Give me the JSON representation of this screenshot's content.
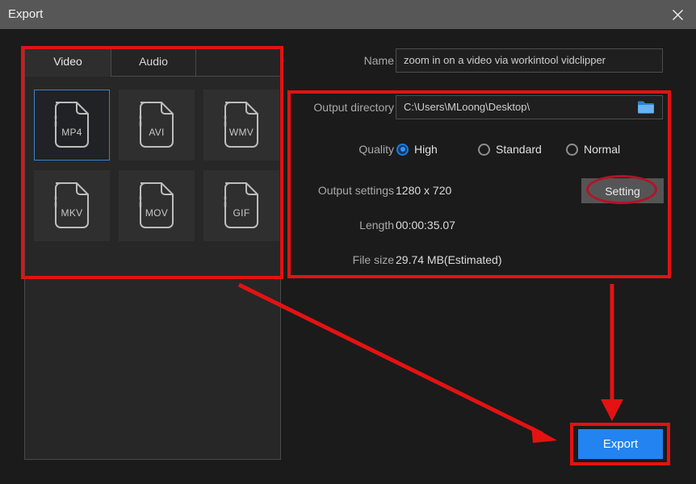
{
  "window": {
    "title": "Export",
    "close_icon": "close-icon"
  },
  "left_panel": {
    "tabs": [
      {
        "label": "Video",
        "active": true
      },
      {
        "label": "Audio",
        "active": false
      },
      {
        "label": "",
        "active": false
      }
    ],
    "formats": [
      {
        "label": "MP4",
        "selected": true
      },
      {
        "label": "AVI",
        "selected": false
      },
      {
        "label": "WMV",
        "selected": false
      },
      {
        "label": "MKV",
        "selected": false
      },
      {
        "label": "MOV",
        "selected": false
      },
      {
        "label": "GIF",
        "selected": false
      }
    ]
  },
  "form": {
    "name_label": "Name",
    "name_value": "zoom in on a video via workintool vidclipper",
    "name_placeholder": "File name",
    "directory_label": "Output directory",
    "directory_value": "C:\\Users\\MLoong\\Desktop\\",
    "directory_placeholder": "Choose output folder",
    "folder_icon": "folder-icon",
    "quality_label": "Quality",
    "quality_options": [
      {
        "label": "High",
        "selected": true
      },
      {
        "label": "Standard",
        "selected": false
      },
      {
        "label": "Normal",
        "selected": false
      }
    ],
    "output_settings_label": "Output settings",
    "output_settings_value": "1280 x 720",
    "setting_button_label": "Setting",
    "length_label": "Length",
    "length_value": "00:00:35.07",
    "filesize_label": "File size",
    "filesize_value": "29.74 MB(Estimated)"
  },
  "actions": {
    "export_label": "Export"
  },
  "colors": {
    "accent_blue": "#2383f0",
    "annotation_red": "#e41212",
    "ellipse_red": "#b51227",
    "titlebar_grey": "#575757",
    "window_bg": "#1b1b1b",
    "panel_bg": "#272727",
    "selected_border": "#3d7fd0"
  },
  "annotations": {
    "left_box": "format-selection-highlight",
    "right_box": "output-options-highlight",
    "export_box": "export-button-highlight",
    "setting_ellipse": "setting-button-highlight",
    "diagonal_arrow": "arrow-to-export",
    "vertical_arrow": "arrow-down-to-export"
  }
}
